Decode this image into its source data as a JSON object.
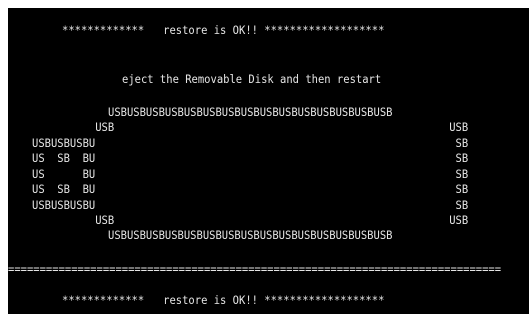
{
  "console": {
    "status_line_top": "*************   restore is OK!! *******************",
    "instruction": "eject the Removable Disk and then restart",
    "usb_art": [
      "USBUSBUSBUSBUSBUSBUSBUSBUSBUSBUSBUSBUSBUSBUSB",
      "          USB                                                     USB",
      "USBUSBUSBU                                                         SB",
      "US  SB  BU                                                         SB",
      "US      BU                                                         SB",
      "US  SB  BU                                                         SB",
      "USBUSBUSBU                                                         SB",
      "          USB                                                     USB",
      "USBUSBUSBUSBUSBUSBUSBUSBUSBUSBUSBUSBUSBUSBUSB"
    ],
    "rule": "==============================================================================",
    "status_line_bottom": "*************   restore is OK!! *******************"
  },
  "colors": {
    "background": "#000000",
    "text": "#e6e6e6"
  }
}
